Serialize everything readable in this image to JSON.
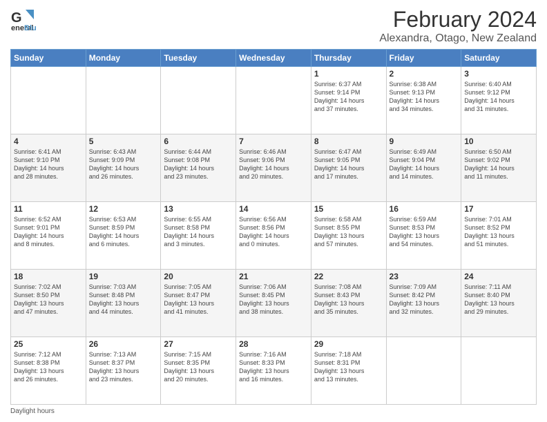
{
  "header": {
    "logo_line1": "General",
    "logo_line2": "Blue",
    "month": "February 2024",
    "location": "Alexandra, Otago, New Zealand"
  },
  "days_of_week": [
    "Sunday",
    "Monday",
    "Tuesday",
    "Wednesday",
    "Thursday",
    "Friday",
    "Saturday"
  ],
  "weeks": [
    [
      {
        "day": "",
        "info": ""
      },
      {
        "day": "",
        "info": ""
      },
      {
        "day": "",
        "info": ""
      },
      {
        "day": "",
        "info": ""
      },
      {
        "day": "1",
        "info": "Sunrise: 6:37 AM\nSunset: 9:14 PM\nDaylight: 14 hours\nand 37 minutes."
      },
      {
        "day": "2",
        "info": "Sunrise: 6:38 AM\nSunset: 9:13 PM\nDaylight: 14 hours\nand 34 minutes."
      },
      {
        "day": "3",
        "info": "Sunrise: 6:40 AM\nSunset: 9:12 PM\nDaylight: 14 hours\nand 31 minutes."
      }
    ],
    [
      {
        "day": "4",
        "info": "Sunrise: 6:41 AM\nSunset: 9:10 PM\nDaylight: 14 hours\nand 28 minutes."
      },
      {
        "day": "5",
        "info": "Sunrise: 6:43 AM\nSunset: 9:09 PM\nDaylight: 14 hours\nand 26 minutes."
      },
      {
        "day": "6",
        "info": "Sunrise: 6:44 AM\nSunset: 9:08 PM\nDaylight: 14 hours\nand 23 minutes."
      },
      {
        "day": "7",
        "info": "Sunrise: 6:46 AM\nSunset: 9:06 PM\nDaylight: 14 hours\nand 20 minutes."
      },
      {
        "day": "8",
        "info": "Sunrise: 6:47 AM\nSunset: 9:05 PM\nDaylight: 14 hours\nand 17 minutes."
      },
      {
        "day": "9",
        "info": "Sunrise: 6:49 AM\nSunset: 9:04 PM\nDaylight: 14 hours\nand 14 minutes."
      },
      {
        "day": "10",
        "info": "Sunrise: 6:50 AM\nSunset: 9:02 PM\nDaylight: 14 hours\nand 11 minutes."
      }
    ],
    [
      {
        "day": "11",
        "info": "Sunrise: 6:52 AM\nSunset: 9:01 PM\nDaylight: 14 hours\nand 8 minutes."
      },
      {
        "day": "12",
        "info": "Sunrise: 6:53 AM\nSunset: 8:59 PM\nDaylight: 14 hours\nand 6 minutes."
      },
      {
        "day": "13",
        "info": "Sunrise: 6:55 AM\nSunset: 8:58 PM\nDaylight: 14 hours\nand 3 minutes."
      },
      {
        "day": "14",
        "info": "Sunrise: 6:56 AM\nSunset: 8:56 PM\nDaylight: 14 hours\nand 0 minutes."
      },
      {
        "day": "15",
        "info": "Sunrise: 6:58 AM\nSunset: 8:55 PM\nDaylight: 13 hours\nand 57 minutes."
      },
      {
        "day": "16",
        "info": "Sunrise: 6:59 AM\nSunset: 8:53 PM\nDaylight: 13 hours\nand 54 minutes."
      },
      {
        "day": "17",
        "info": "Sunrise: 7:01 AM\nSunset: 8:52 PM\nDaylight: 13 hours\nand 51 minutes."
      }
    ],
    [
      {
        "day": "18",
        "info": "Sunrise: 7:02 AM\nSunset: 8:50 PM\nDaylight: 13 hours\nand 47 minutes."
      },
      {
        "day": "19",
        "info": "Sunrise: 7:03 AM\nSunset: 8:48 PM\nDaylight: 13 hours\nand 44 minutes."
      },
      {
        "day": "20",
        "info": "Sunrise: 7:05 AM\nSunset: 8:47 PM\nDaylight: 13 hours\nand 41 minutes."
      },
      {
        "day": "21",
        "info": "Sunrise: 7:06 AM\nSunset: 8:45 PM\nDaylight: 13 hours\nand 38 minutes."
      },
      {
        "day": "22",
        "info": "Sunrise: 7:08 AM\nSunset: 8:43 PM\nDaylight: 13 hours\nand 35 minutes."
      },
      {
        "day": "23",
        "info": "Sunrise: 7:09 AM\nSunset: 8:42 PM\nDaylight: 13 hours\nand 32 minutes."
      },
      {
        "day": "24",
        "info": "Sunrise: 7:11 AM\nSunset: 8:40 PM\nDaylight: 13 hours\nand 29 minutes."
      }
    ],
    [
      {
        "day": "25",
        "info": "Sunrise: 7:12 AM\nSunset: 8:38 PM\nDaylight: 13 hours\nand 26 minutes."
      },
      {
        "day": "26",
        "info": "Sunrise: 7:13 AM\nSunset: 8:37 PM\nDaylight: 13 hours\nand 23 minutes."
      },
      {
        "day": "27",
        "info": "Sunrise: 7:15 AM\nSunset: 8:35 PM\nDaylight: 13 hours\nand 20 minutes."
      },
      {
        "day": "28",
        "info": "Sunrise: 7:16 AM\nSunset: 8:33 PM\nDaylight: 13 hours\nand 16 minutes."
      },
      {
        "day": "29",
        "info": "Sunrise: 7:18 AM\nSunset: 8:31 PM\nDaylight: 13 hours\nand 13 minutes."
      },
      {
        "day": "",
        "info": ""
      },
      {
        "day": "",
        "info": ""
      }
    ]
  ],
  "footer": {
    "text": "Daylight hours"
  }
}
